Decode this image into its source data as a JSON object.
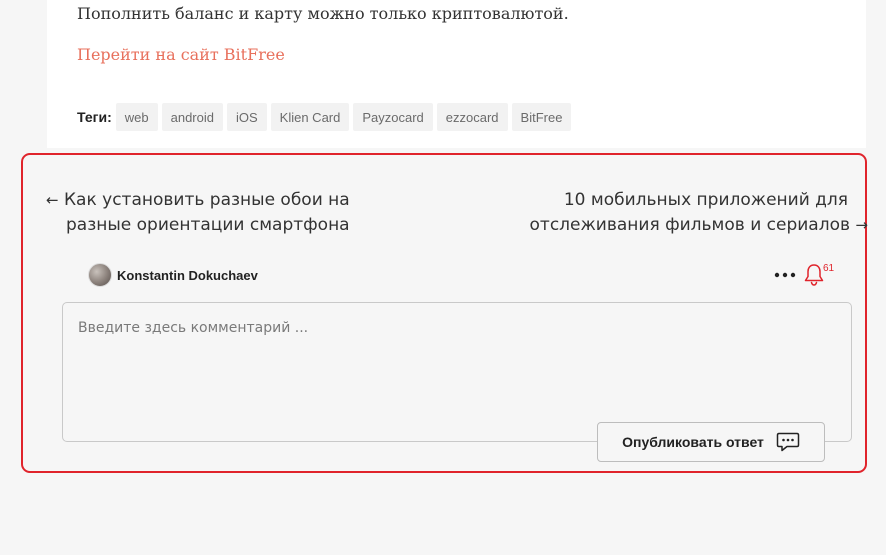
{
  "article": {
    "text": "Пополнить баланс и карту можно только криптовалютой.",
    "link_text": "Перейти на сайт BitFree"
  },
  "tags": {
    "label": "Теги:",
    "items": [
      "web",
      "android",
      "iOS",
      "Klien Card",
      "Payzocard",
      "ezzocard",
      "BitFree"
    ]
  },
  "post_nav": {
    "prev": {
      "arrow": "←",
      "line1": "Как установить разные обои на",
      "line2": "разные ориентации смартфона"
    },
    "next": {
      "arrow": "→",
      "line1": "10 мобильных приложений для",
      "line2": "отслеживания фильмов и сериалов"
    }
  },
  "comment_form": {
    "user_name": "Konstantin Dokuchaev",
    "notification_count": "61",
    "placeholder": "Введите здесь комментарий ...",
    "submit_label": "Опубликовать ответ"
  },
  "colors": {
    "accent_link": "#e8705c",
    "highlight_border": "#e0242c",
    "notification": "#e0242c"
  },
  "icons": {
    "prev_arrow": "arrow-left-icon",
    "next_arrow": "arrow-right-icon",
    "menu": "more-dots-icon",
    "bell": "bell-icon",
    "submit": "chat-bubble-icon"
  }
}
